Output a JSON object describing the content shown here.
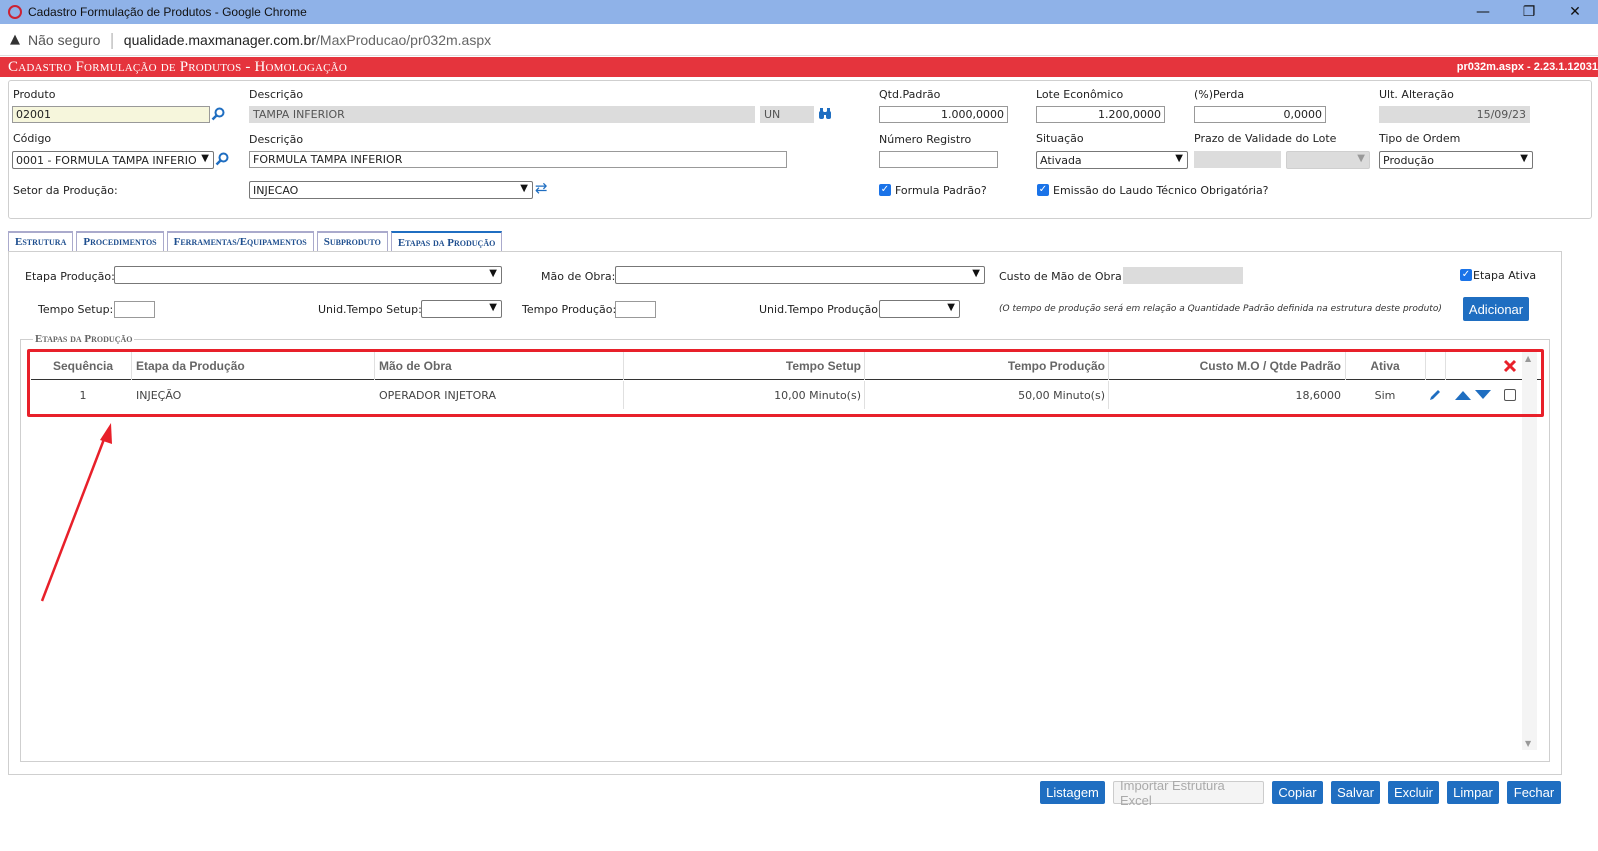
{
  "window": {
    "title": "Cadastro Formulação de Produtos - Google Chrome",
    "address_warning": "Não seguro",
    "url_host": "qualidade.maxmanager.com.br",
    "url_path": "/MaxProducao/pr032m.aspx"
  },
  "header": {
    "title": "Cadastro Formulação de Produtos  - Homologação",
    "version": "pr032m.aspx - 2.23.1.12031"
  },
  "form": {
    "produto_label": "Produto",
    "produto_value": "02001",
    "descricao1_label": "Descrição",
    "descricao1_value": "TAMPA INFERIOR",
    "unidade_value": "UN",
    "qtd_padrao_label": "Qtd.Padrão",
    "qtd_padrao_value": "1.000,0000",
    "lote_label": "Lote Econômico",
    "lote_value": "1.200,0000",
    "perda_label": "(%)Perda",
    "perda_value": "0,0000",
    "ult_alteracao_label": "Ult. Alteração",
    "ult_alteracao_value": "15/09/23",
    "codigo_label": "Código",
    "codigo_value": "0001 - FORMULA TAMPA INFERIO",
    "descricao2_label": "Descrição",
    "descricao2_value": "FORMULA TAMPA INFERIOR",
    "numero_registro_label": "Número Registro",
    "numero_registro_value": "",
    "situacao_label": "Situação",
    "situacao_value": "Ativada",
    "prazo_label": "Prazo de Validade do Lote",
    "tipo_ordem_label": "Tipo de Ordem",
    "tipo_ordem_value": "Produção",
    "setor_label": "Setor da Produção:",
    "setor_value": "INJECAO",
    "formula_padrao_label": "Formula Padrão?",
    "formula_padrao_checked": true,
    "laudo_label": "Emissão do Laudo Técnico Obrigatória?",
    "laudo_checked": true
  },
  "tabs": [
    {
      "label": "Estrutura",
      "active": false
    },
    {
      "label": "Procedimentos",
      "active": false
    },
    {
      "label": "Ferramentas/Equipamentos",
      "active": false
    },
    {
      "label": "Subproduto",
      "active": false
    },
    {
      "label": "Etapas da Produção",
      "active": true
    }
  ],
  "etapas_form": {
    "etapa_label": "Etapa Produção:",
    "etapa_value": "",
    "mao_obra_label": "Mão de Obra:",
    "mao_obra_value": "",
    "custo_label": "Custo de Mão de Obra:",
    "custo_value": "",
    "etapa_ativa_label": "Etapa Ativa",
    "etapa_ativa_checked": true,
    "tempo_setup_label": "Tempo Setup:",
    "tempo_setup_value": "",
    "unid_setup_label": "Unid.Tempo Setup:",
    "unid_setup_value": "",
    "tempo_producao_label": "Tempo Produção:",
    "tempo_producao_value": "",
    "unid_producao_label": "Unid.Tempo Produção:",
    "unid_producao_value": "",
    "note": "(O tempo de produção será em relação a Quantidade Padrão definida na estrutura deste produto)",
    "add_button": "Adicionar"
  },
  "grid": {
    "legend": "Etapas da Produção",
    "columns": [
      "Sequência",
      "Etapa da Produção",
      "Mão de Obra",
      "Tempo Setup",
      "Tempo Produção",
      "Custo M.O / Qtde Padrão",
      "Ativa"
    ],
    "rows": [
      {
        "sequencia": "1",
        "etapa": "INJEÇÃO",
        "mao_obra": "OPERADOR INJETORA",
        "tempo_setup": "10,00 Minuto(s)",
        "tempo_producao": "50,00 Minuto(s)",
        "custo": "18,6000",
        "ativa": "Sim"
      }
    ]
  },
  "footer_buttons": {
    "listagem": "Listagem",
    "importar": "Importar Estrutura Excel",
    "copiar": "Copiar",
    "salvar": "Salvar",
    "excluir": "Excluir",
    "limpar": "Limpar",
    "fechar": "Fechar"
  },
  "colors": {
    "header_red": "#e5343d",
    "primary_blue": "#1f6ec1",
    "highlight_red": "#e8202a",
    "titlebar_blue": "#8fb2e8"
  },
  "icons": {
    "search": "magnifier",
    "binoculars": "binoculars",
    "refresh": "refresh-arrows",
    "edit": "pencil",
    "move_up": "triangle-up",
    "move_down": "triangle-down",
    "delete_all": "red-x"
  }
}
